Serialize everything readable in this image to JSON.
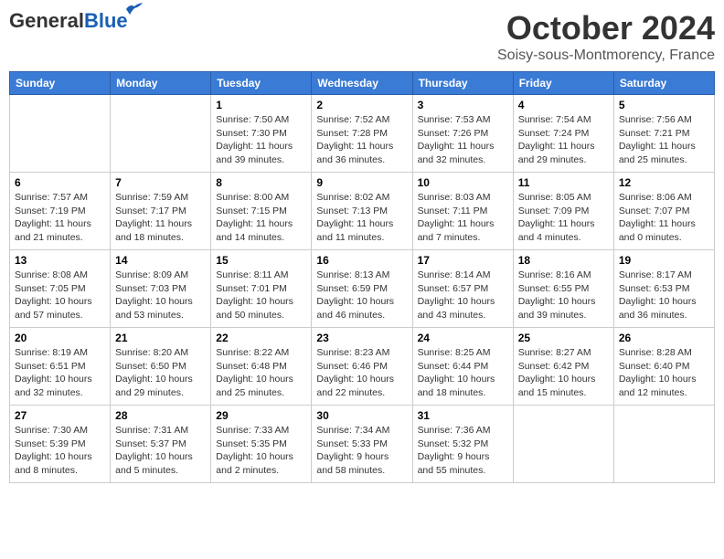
{
  "header": {
    "logo_general": "General",
    "logo_blue": "Blue",
    "month": "October 2024",
    "location": "Soisy-sous-Montmorency, France"
  },
  "days_of_week": [
    "Sunday",
    "Monday",
    "Tuesday",
    "Wednesday",
    "Thursday",
    "Friday",
    "Saturday"
  ],
  "weeks": [
    [
      {
        "day": "",
        "content": ""
      },
      {
        "day": "",
        "content": ""
      },
      {
        "day": "1",
        "content": "Sunrise: 7:50 AM\nSunset: 7:30 PM\nDaylight: 11 hours and 39 minutes."
      },
      {
        "day": "2",
        "content": "Sunrise: 7:52 AM\nSunset: 7:28 PM\nDaylight: 11 hours and 36 minutes."
      },
      {
        "day": "3",
        "content": "Sunrise: 7:53 AM\nSunset: 7:26 PM\nDaylight: 11 hours and 32 minutes."
      },
      {
        "day": "4",
        "content": "Sunrise: 7:54 AM\nSunset: 7:24 PM\nDaylight: 11 hours and 29 minutes."
      },
      {
        "day": "5",
        "content": "Sunrise: 7:56 AM\nSunset: 7:21 PM\nDaylight: 11 hours and 25 minutes."
      }
    ],
    [
      {
        "day": "6",
        "content": "Sunrise: 7:57 AM\nSunset: 7:19 PM\nDaylight: 11 hours and 21 minutes."
      },
      {
        "day": "7",
        "content": "Sunrise: 7:59 AM\nSunset: 7:17 PM\nDaylight: 11 hours and 18 minutes."
      },
      {
        "day": "8",
        "content": "Sunrise: 8:00 AM\nSunset: 7:15 PM\nDaylight: 11 hours and 14 minutes."
      },
      {
        "day": "9",
        "content": "Sunrise: 8:02 AM\nSunset: 7:13 PM\nDaylight: 11 hours and 11 minutes."
      },
      {
        "day": "10",
        "content": "Sunrise: 8:03 AM\nSunset: 7:11 PM\nDaylight: 11 hours and 7 minutes."
      },
      {
        "day": "11",
        "content": "Sunrise: 8:05 AM\nSunset: 7:09 PM\nDaylight: 11 hours and 4 minutes."
      },
      {
        "day": "12",
        "content": "Sunrise: 8:06 AM\nSunset: 7:07 PM\nDaylight: 11 hours and 0 minutes."
      }
    ],
    [
      {
        "day": "13",
        "content": "Sunrise: 8:08 AM\nSunset: 7:05 PM\nDaylight: 10 hours and 57 minutes."
      },
      {
        "day": "14",
        "content": "Sunrise: 8:09 AM\nSunset: 7:03 PM\nDaylight: 10 hours and 53 minutes."
      },
      {
        "day": "15",
        "content": "Sunrise: 8:11 AM\nSunset: 7:01 PM\nDaylight: 10 hours and 50 minutes."
      },
      {
        "day": "16",
        "content": "Sunrise: 8:13 AM\nSunset: 6:59 PM\nDaylight: 10 hours and 46 minutes."
      },
      {
        "day": "17",
        "content": "Sunrise: 8:14 AM\nSunset: 6:57 PM\nDaylight: 10 hours and 43 minutes."
      },
      {
        "day": "18",
        "content": "Sunrise: 8:16 AM\nSunset: 6:55 PM\nDaylight: 10 hours and 39 minutes."
      },
      {
        "day": "19",
        "content": "Sunrise: 8:17 AM\nSunset: 6:53 PM\nDaylight: 10 hours and 36 minutes."
      }
    ],
    [
      {
        "day": "20",
        "content": "Sunrise: 8:19 AM\nSunset: 6:51 PM\nDaylight: 10 hours and 32 minutes."
      },
      {
        "day": "21",
        "content": "Sunrise: 8:20 AM\nSunset: 6:50 PM\nDaylight: 10 hours and 29 minutes."
      },
      {
        "day": "22",
        "content": "Sunrise: 8:22 AM\nSunset: 6:48 PM\nDaylight: 10 hours and 25 minutes."
      },
      {
        "day": "23",
        "content": "Sunrise: 8:23 AM\nSunset: 6:46 PM\nDaylight: 10 hours and 22 minutes."
      },
      {
        "day": "24",
        "content": "Sunrise: 8:25 AM\nSunset: 6:44 PM\nDaylight: 10 hours and 18 minutes."
      },
      {
        "day": "25",
        "content": "Sunrise: 8:27 AM\nSunset: 6:42 PM\nDaylight: 10 hours and 15 minutes."
      },
      {
        "day": "26",
        "content": "Sunrise: 8:28 AM\nSunset: 6:40 PM\nDaylight: 10 hours and 12 minutes."
      }
    ],
    [
      {
        "day": "27",
        "content": "Sunrise: 7:30 AM\nSunset: 5:39 PM\nDaylight: 10 hours and 8 minutes."
      },
      {
        "day": "28",
        "content": "Sunrise: 7:31 AM\nSunset: 5:37 PM\nDaylight: 10 hours and 5 minutes."
      },
      {
        "day": "29",
        "content": "Sunrise: 7:33 AM\nSunset: 5:35 PM\nDaylight: 10 hours and 2 minutes."
      },
      {
        "day": "30",
        "content": "Sunrise: 7:34 AM\nSunset: 5:33 PM\nDaylight: 9 hours and 58 minutes."
      },
      {
        "day": "31",
        "content": "Sunrise: 7:36 AM\nSunset: 5:32 PM\nDaylight: 9 hours and 55 minutes."
      },
      {
        "day": "",
        "content": ""
      },
      {
        "day": "",
        "content": ""
      }
    ]
  ]
}
